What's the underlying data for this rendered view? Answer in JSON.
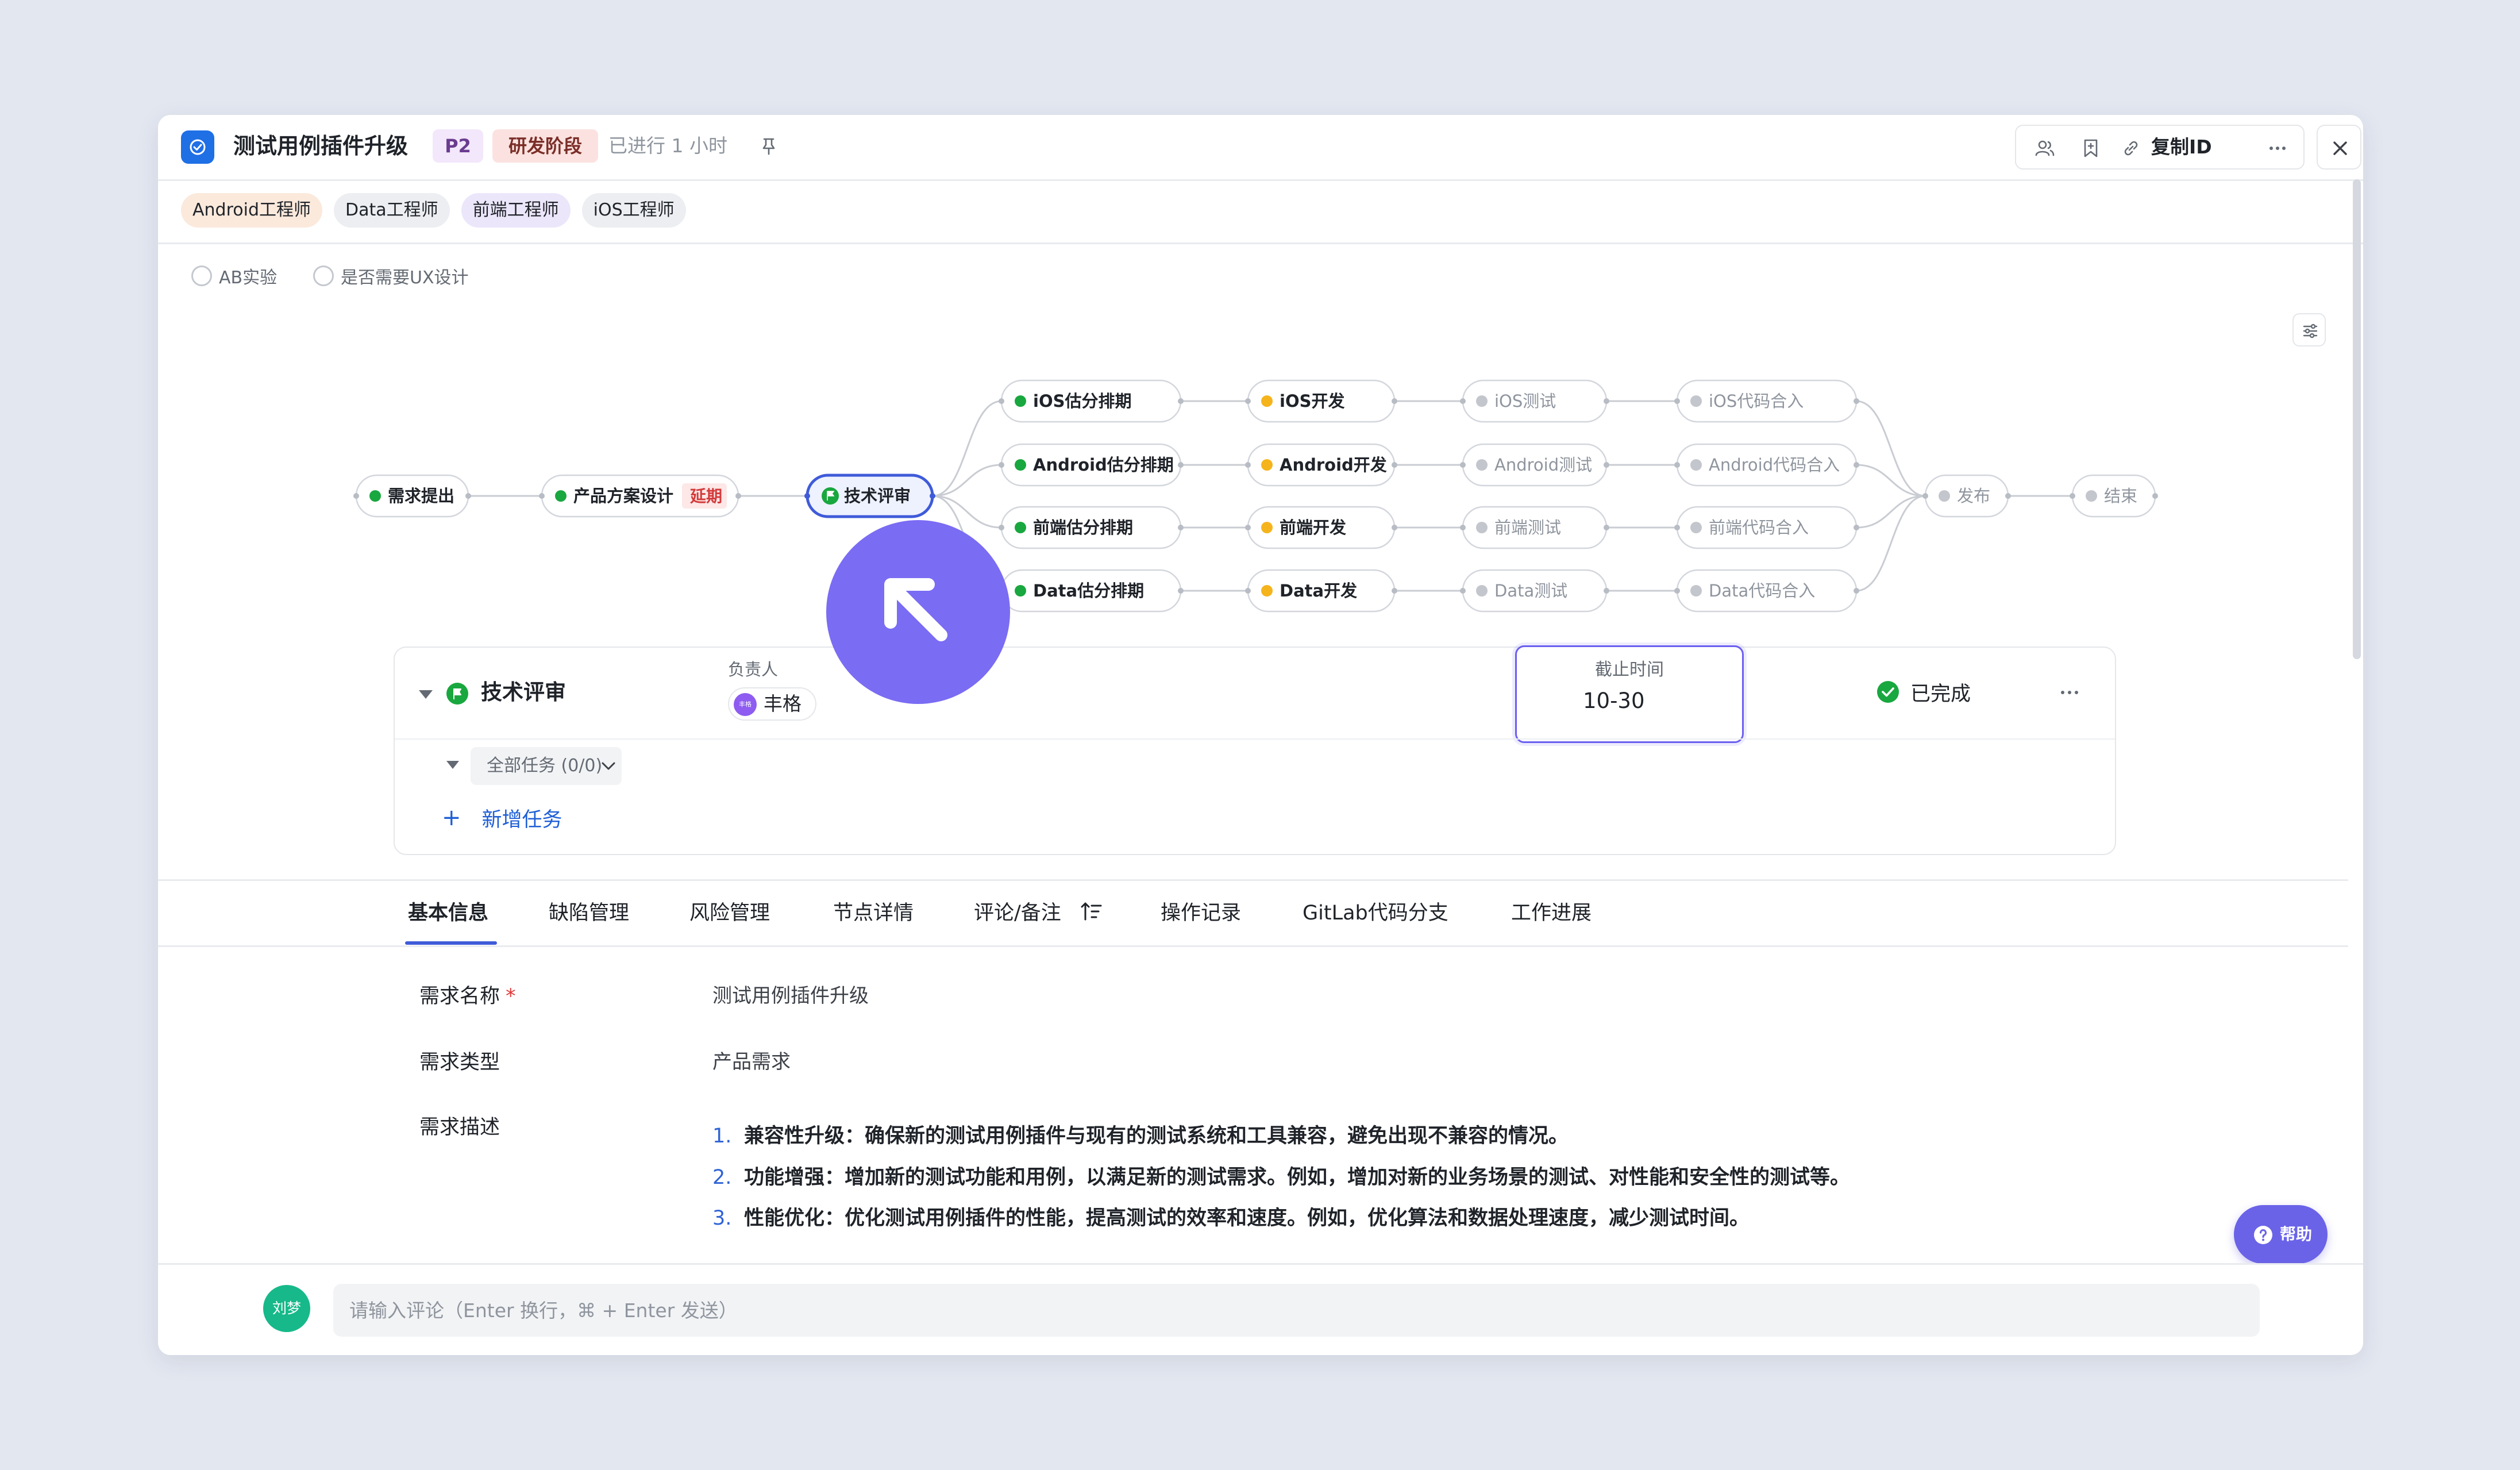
{
  "header": {
    "title": "测试用例插件升级",
    "priority": "P2",
    "stage": "研发阶段",
    "elapsed": "已进行 1 小时",
    "copy_id": "复制ID"
  },
  "roles": [
    "Android工程师",
    "Data工程师",
    "前端工程师",
    "iOS工程师"
  ],
  "role_colors": [
    "#fbe9dc",
    "#eceef1",
    "#ece6fb",
    "#eceef1"
  ],
  "options": {
    "ab_test": "AB实验",
    "ux_design": "是否需要UX设计"
  },
  "flow": {
    "nodes": [
      {
        "label": "需求提出",
        "status": "done"
      },
      {
        "label": "产品方案设计",
        "status": "done",
        "badge": "延期"
      },
      {
        "label": "技术评审",
        "status": "current"
      },
      {
        "label": "iOS估分排期",
        "status": "done"
      },
      {
        "label": "Android估分排期",
        "status": "done"
      },
      {
        "label": "前端估分排期",
        "status": "done"
      },
      {
        "label": "Data估分排期",
        "status": "done"
      },
      {
        "label": "iOS开发",
        "status": "in-progress"
      },
      {
        "label": "Android开发",
        "status": "in-progress"
      },
      {
        "label": "前端开发",
        "status": "in-progress"
      },
      {
        "label": "Data开发",
        "status": "in-progress"
      },
      {
        "label": "iOS测试",
        "status": "pending"
      },
      {
        "label": "Android测试",
        "status": "pending"
      },
      {
        "label": "前端测试",
        "status": "pending"
      },
      {
        "label": "Data测试",
        "status": "pending"
      },
      {
        "label": "iOS代码合入",
        "status": "pending"
      },
      {
        "label": "Android代码合入",
        "status": "pending"
      },
      {
        "label": "前端代码合入",
        "status": "pending"
      },
      {
        "label": "Data代码合入",
        "status": "pending"
      },
      {
        "label": "发布",
        "status": "pending"
      },
      {
        "label": "结束",
        "status": "pending"
      }
    ],
    "status_colors": {
      "done": "#19a73f",
      "in-progress": "#f5b41b",
      "pending": "#c3c6cc",
      "current": "#19a73f"
    }
  },
  "node_detail": {
    "title": "技术评审",
    "owner_label": "负责人",
    "owner_name": "丰格",
    "owner_avatar_text": "丰格",
    "due_label": "截止时间",
    "due_value": "10-30",
    "status": "已完成",
    "subtasks": "全部任务 (0/0)",
    "add_task": "新增任务"
  },
  "tabs": [
    "基本信息",
    "缺陷管理",
    "风险管理",
    "节点详情",
    "评论/备注",
    "操作记录",
    "GitLab代码分支",
    "工作进展"
  ],
  "active_tab": "基本信息",
  "fields": {
    "name_label": "需求名称",
    "name_required": "*",
    "name_value": "测试用例插件升级",
    "type_label": "需求类型",
    "type_value": "产品需求",
    "desc_label": "需求描述",
    "desc_items": [
      {
        "num": "1.",
        "text": "兼容性升级：确保新的测试用例插件与现有的测试系统和工具兼容，避免出现不兼容的情况。"
      },
      {
        "num": "2.",
        "text": "功能增强：增加新的测试功能和用例，以满足新的测试需求。例如，增加对新的业务场景的测试、对性能和安全性的测试等。"
      },
      {
        "num": "3.",
        "text": "性能优化：优化测试用例插件的性能，提高测试的效率和速度。例如，优化算法和数据处理速度，减少测试时间。"
      }
    ]
  },
  "help": "帮助",
  "comment": {
    "avatar_text": "刘梦",
    "placeholder": "请输入评论（Enter 换行，⌘ + Enter 发送）"
  },
  "colors": {
    "accent": "#3f5bd9",
    "cursor": "#7a6cf3",
    "done_green": "#19a73f",
    "in_progress_yellow": "#f5b41b"
  },
  "icons": [
    "app-check-icon",
    "pin-icon",
    "members-icon",
    "bookmark-icon",
    "link-icon",
    "more-icon",
    "close-icon",
    "settings-sliders-icon",
    "flag-icon",
    "check-circle-icon",
    "sort-icon",
    "help-icon",
    "cursor-arrow-icon"
  ]
}
